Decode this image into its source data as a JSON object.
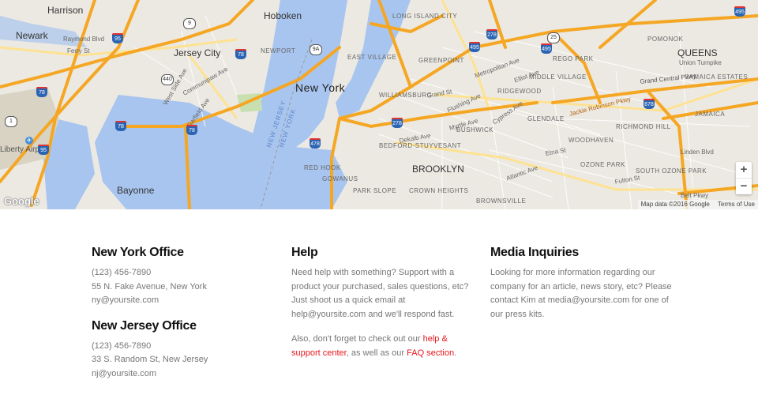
{
  "map": {
    "labels": {
      "harrison": "Harrison",
      "newark": "Newark",
      "raymond": "Raymond Blvd",
      "ferry": "Ferry St",
      "hoboken": "Hoboken",
      "jersey_city": "Jersey City",
      "newport": "NEWPORT",
      "new_york": "New York",
      "greenpoint": "GREENPOINT",
      "east_village": "EAST VILLAGE",
      "williamsburg": "WILLIAMSBURG",
      "middle_village": "MIDDLE VILLAGE",
      "ridgewood": "RIDGEWOOD",
      "glendale": "GLENDALE",
      "bushwick": "BUSHWICK",
      "bed_stuy": "BEDFORD-STUYVESANT",
      "brooklyn": "BROOKLYN",
      "crown_heights": "CROWN HEIGHTS",
      "park_slope": "PARK SLOPE",
      "gowanus": "GOWANUS",
      "red_hook": "RED HOOK",
      "brownsville": "BROWNSVILLE",
      "rego_park": "REGO PARK",
      "pomonok": "POMONOK",
      "queens": "QUEENS",
      "jamaica_estates": "JAMAICA ESTATES",
      "richmond_hill": "RICHMOND HILL",
      "woodhaven": "WOODHAVEN",
      "ozone_park": "OZONE PARK",
      "south_ozone_park": "SOUTH OZONE PARK",
      "jamaica": "JAMAICA",
      "long_island_city": "LONG ISLAND CITY",
      "bayonne": "Bayonne",
      "liberty_airport": "Liberty Airport",
      "new_jersey": "NEW JERSEY",
      "new_york_water": "NEW YORK",
      "jackie_robinson": "Jackie Robinson Pkwy",
      "grand_central": "Grand Central Pkwy",
      "union_tpke": "Union Turnpike",
      "linden_blvd": "Linden Blvd",
      "belt_pkwy": "Belt Pkwy",
      "atlantic_ave": "Atlantic Ave",
      "myrtle_ave": "Myrtle Ave",
      "dekalb_ave": "Dekalb Ave",
      "flushing_ave": "Flushing Ave",
      "grand_st": "Grand St",
      "metropolitan": "Metropolitan Ave",
      "fulton": "Fulton St",
      "etna": "Etna St",
      "cypress": "Cypress Ave",
      "elliot": "Elliot Ave",
      "communipaw": "Communipaw Ave",
      "garfield": "Garfield Ave",
      "west_side": "West Side Ave"
    },
    "shields": {
      "i95": "95",
      "i78a": "78",
      "i78b": "78",
      "i78c": "78",
      "i278": "278",
      "i278b": "278",
      "i478": "478",
      "i495": "495",
      "i495b": "495",
      "i678": "678",
      "s440": "440",
      "s1": "1",
      "s9": "9",
      "s9a": "9A",
      "s25": "25"
    },
    "google": "Google",
    "map_data": "Map data ©2016 Google",
    "terms": "Terms of Use",
    "zoom_in": "+",
    "zoom_out": "−"
  },
  "offices": {
    "ny": {
      "title": "New York Office",
      "phone": "(123) 456-7890",
      "address": "55 N. Fake Avenue, New York",
      "email": "ny@yoursite.com"
    },
    "nj": {
      "title": "New Jersey Office",
      "phone": "(123) 456-7890",
      "address": "33 S. Random St, New Jersey",
      "email": "nj@yoursite.com"
    }
  },
  "help": {
    "title": "Help",
    "lines": [
      "Need help with something? Support with a",
      "product your purchased, sales questions, etc?",
      "Just shoot us a quick email at",
      "help@yoursite.com and we'll respond fast."
    ],
    "p2_line1_a": "Also, don't forget to check out our ",
    "help_link_1": "help &",
    "help_link_2": "support center",
    "p2_line2_b": ", as well as our ",
    "faq_link": "FAQ section",
    "p2_end": "."
  },
  "media": {
    "title": "Media Inquiries",
    "lines": [
      "Looking for more information regarding our",
      "company for an article, news story, etc? Please",
      "contact Kim at media@yoursite.com for one of",
      "our press kits."
    ]
  },
  "colors": {
    "highway": "#f5a623",
    "water": "#a8c5ef",
    "land": "#ece9e2",
    "link": "#e8161d"
  }
}
